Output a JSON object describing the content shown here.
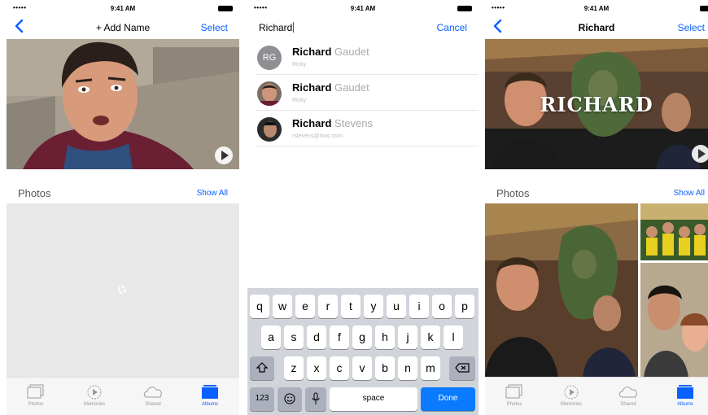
{
  "status": {
    "signal": "•••••",
    "time": "9:41 AM"
  },
  "screen1": {
    "nav": {
      "title": "+ Add Name",
      "action": "Select"
    },
    "section": {
      "title": "Photos",
      "action": "Show All"
    }
  },
  "screen2": {
    "search": {
      "query": "Richard",
      "cancel": "Cancel"
    },
    "results": [
      {
        "first": "Richard",
        "rest": "Gaudet",
        "sub": "Ricky",
        "initials": "RG"
      },
      {
        "first": "Richard",
        "rest": "Gaudet",
        "sub": "Ricky"
      },
      {
        "first": "Richard",
        "rest": "Stevens",
        "sub": "rstevens@mac.com"
      }
    ],
    "keyboard": {
      "row1": [
        "q",
        "w",
        "e",
        "r",
        "t",
        "y",
        "u",
        "i",
        "o",
        "p"
      ],
      "row2": [
        "a",
        "s",
        "d",
        "f",
        "g",
        "h",
        "j",
        "k",
        "l"
      ],
      "row3": [
        "z",
        "x",
        "c",
        "v",
        "b",
        "n",
        "m"
      ],
      "numbers": "123",
      "space": "space",
      "done": "Done"
    }
  },
  "screen3": {
    "nav": {
      "title": "Richard",
      "action": "Select"
    },
    "banner": "RICHARD",
    "section": {
      "title": "Photos",
      "action": "Show All"
    }
  },
  "tabs": [
    "Photos",
    "Memories",
    "Shared",
    "Albums"
  ],
  "colors": {
    "accent": "#0a60ff",
    "keyboard": "#d1d5db",
    "done_key": "#0a7aff"
  }
}
